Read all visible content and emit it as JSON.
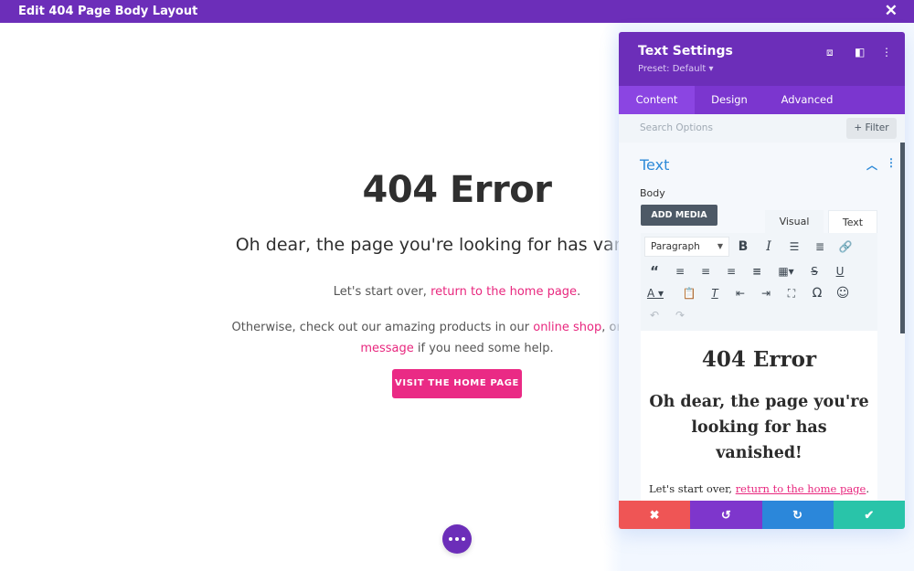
{
  "topbar": {
    "title": "Edit 404 Page Body Layout",
    "close_icon": "close-icon"
  },
  "page": {
    "heading": "404 Error",
    "subheading": "Oh dear, the page you're looking for has vanished!",
    "p1_prefix": "Let's start over, ",
    "p1_link": "return to the home page",
    "p1_suffix": ".",
    "p2_prefix": "Otherwise, check out our amazing products in our ",
    "p2_link1": "online shop",
    "p2_mid": ", or send us a ",
    "p2_link2": "message",
    "p2_suffix": " if you need some help.",
    "cta": "VISIT THE HOME PAGE",
    "link_color": "#e8277e",
    "button_color": "#ea2a85"
  },
  "modal": {
    "title": "Text Settings",
    "preset": "Preset: Default ▾",
    "header_icons": [
      "focus-icon",
      "split-view-icon",
      "more-vertical-icon"
    ],
    "tabs": [
      {
        "label": "Content",
        "active": true
      },
      {
        "label": "Design",
        "active": false
      },
      {
        "label": "Advanced",
        "active": false
      }
    ],
    "search_placeholder": "Search Options",
    "filter_label": "+ Filter",
    "section_title": "Text",
    "body_label": "Body",
    "add_media": "ADD MEDIA",
    "editor_tabs": {
      "visual": "Visual",
      "text": "Text"
    },
    "format_select": "Paragraph",
    "editor": {
      "heading": "404 Error",
      "subheading": "Oh dear, the page you're looking for has vanished!",
      "p_prefix": "Let's start over, ",
      "p_link": "return to the home page",
      "p_suffix": "."
    },
    "footer": [
      {
        "name": "discard",
        "icon": "✖",
        "color": "#ef5555"
      },
      {
        "name": "undo",
        "icon": "↺",
        "color": "#7e36cc"
      },
      {
        "name": "redo",
        "icon": "↻",
        "color": "#2b87da"
      },
      {
        "name": "save",
        "icon": "✔",
        "color": "#29c4a9"
      }
    ]
  },
  "colors": {
    "brand_purple": "#6c2eb9",
    "tab_purple": "#7b36cf",
    "accent_blue": "#2e8ad8"
  }
}
